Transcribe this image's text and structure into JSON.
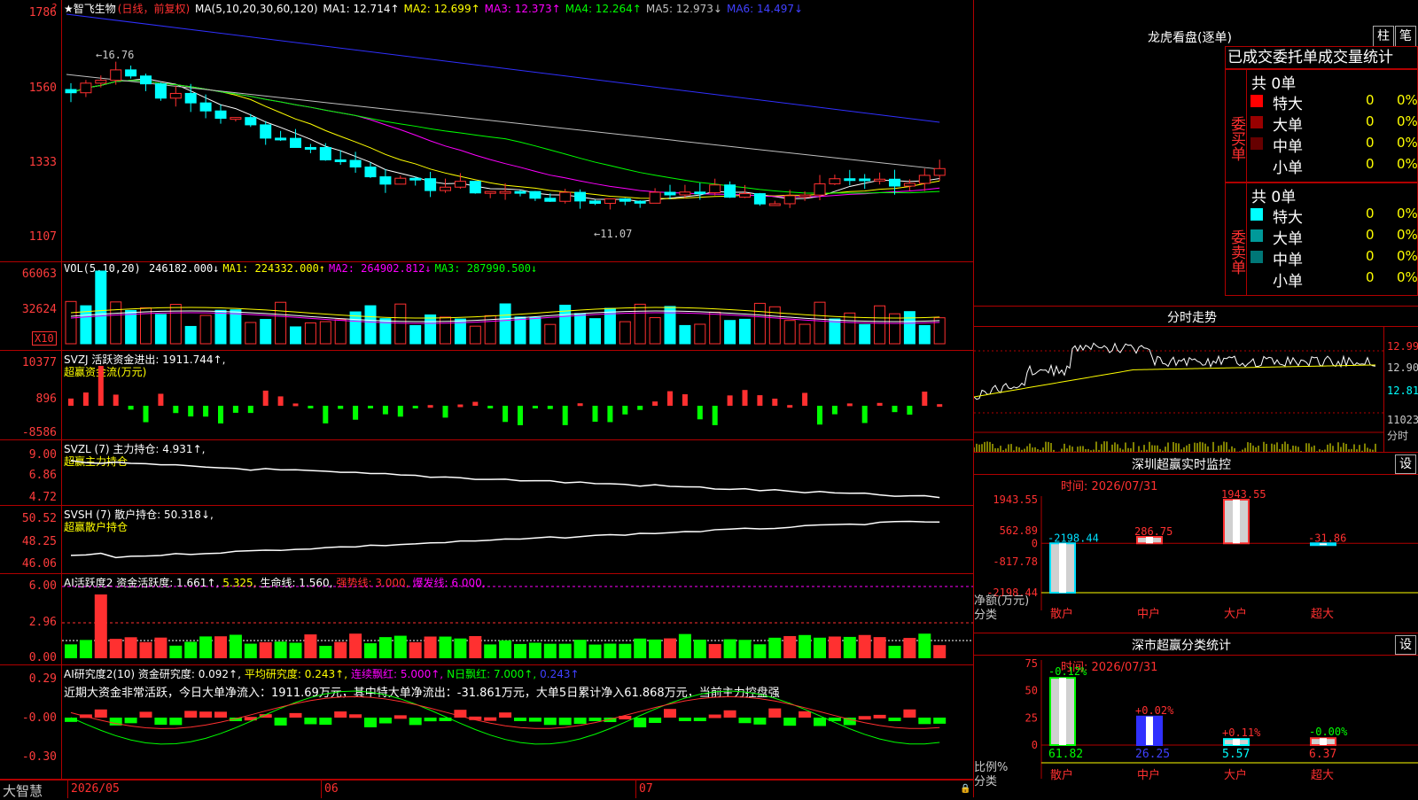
{
  "header": {
    "stock_name": "★智飞生物",
    "period": "(日线，前复权)",
    "ma_label": "MA(5,10,20,30,60,120)",
    "ma_values": [
      {
        "label": "MA1:",
        "value": "12.714↑",
        "color": "#ffffff"
      },
      {
        "label": "MA2:",
        "value": "12.699↑",
        "color": "#ffff00"
      },
      {
        "label": "MA3:",
        "value": "12.373↑",
        "color": "#ff00ff"
      },
      {
        "label": "MA4:",
        "value": "12.264↑",
        "color": "#00ff00"
      },
      {
        "label": "MA5:",
        "value": "12.973↓",
        "color": "#c0c0c0"
      },
      {
        "label": "MA6:",
        "value": "14.497↓",
        "color": "#4040ff"
      }
    ],
    "corner_mark": "?"
  },
  "price_panel": {
    "y_labels": [
      "1786",
      "1560",
      "1333",
      "1107"
    ],
    "high_label": "←16.76",
    "low_label": "←11.07"
  },
  "vol_panel": {
    "title": "VOL(5,10,20)",
    "items": [
      {
        "text": "246182.000↓",
        "color": "#ffffff"
      },
      {
        "text": "MA1: 224332.000↑",
        "color": "#ffff00"
      },
      {
        "text": "MA2: 264902.812↓",
        "color": "#ff00ff"
      },
      {
        "text": "MA3: 287990.500↓",
        "color": "#00ff00"
      }
    ],
    "y_labels": [
      "66063",
      "32624"
    ],
    "unit": "X10"
  },
  "svzj_panel": {
    "title": "SVZJ  活跃资金进出: 1911.744↑,",
    "subtitle": "超赢资金流(万元)",
    "y_labels": [
      "10377",
      "896",
      "-8586"
    ]
  },
  "svzl_panel": {
    "title": "SVZL (7) 主力持仓: 4.931↑,",
    "subtitle": "超赢主力持仓",
    "y_labels": [
      "9.00",
      "6.86",
      "4.72"
    ]
  },
  "svsh_panel": {
    "title": "SVSH (7) 散户持仓: 50.318↓,",
    "subtitle": "超赢散户持仓",
    "y_labels": [
      "50.52",
      "48.25",
      "46.06"
    ]
  },
  "ai_active_panel": {
    "items": [
      {
        "text": "AI活跃度2 资金活跃度: 1.661↑,",
        "color": "#ffffff"
      },
      {
        "text": "5.325,",
        "color": "#ffff00"
      },
      {
        "text": "生命线: 1.560,",
        "color": "#ffffff"
      },
      {
        "text": "强势线: 3.000,",
        "color": "#ff3030"
      },
      {
        "text": "爆发线: 6.000,",
        "color": "#ff00ff"
      }
    ],
    "y_labels": [
      "6.00",
      "2.96",
      "0.00"
    ]
  },
  "ai_research_panel": {
    "items": [
      {
        "text": "AI研究度2(10) 资金研究度: 0.092↑,",
        "color": "#ffffff"
      },
      {
        "text": "平均研究度: 0.243↑,",
        "color": "#ffff00"
      },
      {
        "text": "连续飘红: 5.000↑,",
        "color": "#ff00ff"
      },
      {
        "text": "N日飘红: 7.000↑,",
        "color": "#00ff00"
      },
      {
        "text": "0.243↑",
        "color": "#4040ff"
      }
    ],
    "comment": "近期大资金非常活跃，今日大单净流入：1911.69万元，其中特大单净流出：-31.861万元，大单5日累计净入61.868万元，当前主力控盘强",
    "y_labels": [
      "0.29",
      "-0.00",
      "-0.30"
    ]
  },
  "footer": {
    "logo": "大智慧",
    "dates": [
      "2026/05",
      "06",
      "07"
    ]
  },
  "lhb": {
    "title": "龙虎看盘(逐单)",
    "btn_zhu": "柱",
    "btn_bi": "笔",
    "header": "已成交委托单成交量统计",
    "buy_label": "委买单",
    "sell_label": "委卖单",
    "buy_total": "共 0单",
    "sell_total": "共 0单",
    "buy_rows": [
      {
        "name": "特大",
        "count": "0",
        "pct": "0%",
        "color": "#ff0000"
      },
      {
        "name": "大单",
        "count": "0",
        "pct": "0%",
        "color": "#990000"
      },
      {
        "name": "中单",
        "count": "0",
        "pct": "0%",
        "color": "#660000"
      },
      {
        "name": "小单",
        "count": "0",
        "pct": "0%",
        "color": ""
      }
    ],
    "sell_rows": [
      {
        "name": "特大",
        "count": "0",
        "pct": "0%",
        "color": "#00ffff"
      },
      {
        "name": "大单",
        "count": "0",
        "pct": "0%",
        "color": "#009999"
      },
      {
        "name": "中单",
        "count": "0",
        "pct": "0%",
        "color": "#007777"
      },
      {
        "name": "小单",
        "count": "0",
        "pct": "0%",
        "color": ""
      }
    ]
  },
  "intraday": {
    "title": "分时走势",
    "price_labels": [
      "12.99",
      "12.90",
      "12.81"
    ],
    "vol_label": "11023",
    "vol_sub": "分时"
  },
  "sz_monitor": {
    "title": "深圳超赢实时监控",
    "btn": "设",
    "time": "时间: 2026/07/31",
    "y_labels": [
      "1943.55",
      "562.89",
      "0",
      "-817.78",
      "-2198.44"
    ],
    "y_title": "净额(万元)",
    "x_title": "分类",
    "chart_data": {
      "type": "bar",
      "categories": [
        "散户",
        "中户",
        "大户",
        "超大"
      ],
      "values": [
        -2198.44,
        286.75,
        1943.55,
        -31.86
      ],
      "value_labels": [
        "-2198.44",
        "286.75",
        "1943.55",
        "-31.86"
      ],
      "ylim": [
        -2198.44,
        1943.55
      ]
    }
  },
  "sz_class": {
    "title": "深市超赢分类统计",
    "btn": "设",
    "time": "时间: 2026/07/31",
    "y_labels": [
      "75",
      "50",
      "25",
      "0"
    ],
    "y_title": "比例%",
    "x_title": "分类",
    "chart_data": {
      "type": "bar",
      "categories": [
        "散户",
        "中户",
        "大户",
        "超大"
      ],
      "values": [
        61.82,
        26.25,
        5.57,
        6.37
      ],
      "change_labels": [
        "-0.12%",
        "+0.02%",
        "+0.11%",
        "-0.00%"
      ],
      "ylim": [
        0,
        75
      ]
    }
  }
}
